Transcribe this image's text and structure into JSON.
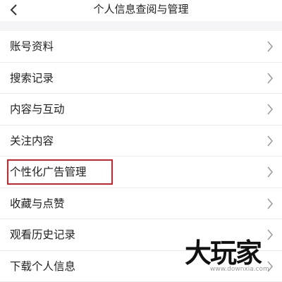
{
  "header": {
    "title": "个人信息查阅与管理"
  },
  "list": {
    "items": [
      {
        "label": "账号资料"
      },
      {
        "label": "搜索记录"
      },
      {
        "label": "内容与互动"
      },
      {
        "label": "关注内容"
      },
      {
        "label": "个性化广告管理"
      },
      {
        "label": "收藏与点赞"
      },
      {
        "label": "观看历史记录"
      },
      {
        "label": "下载个人信息"
      }
    ]
  },
  "watermark": {
    "logo_text": "大玩家",
    "site": "www.downxia.com"
  },
  "colors": {
    "highlight": "#d2232a",
    "background": "#f5f5f7"
  }
}
